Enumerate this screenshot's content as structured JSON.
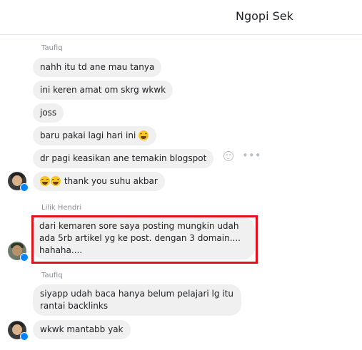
{
  "header": {
    "title": "Ngopi Sek"
  },
  "groups": [
    {
      "sender": "Taufiq",
      "messages": [
        "nahh itu td ane mau tanya",
        "ini keren amat om skrg wkwk",
        "joss",
        "baru pakai lagi hari ini",
        "dr pagi keasikan ane temakin blogspot",
        "thank you suhu akbar"
      ]
    },
    {
      "sender": "Lilik Hendri",
      "messages": [
        "dari kemaren sore saya posting mungkin udah ada 5rb artikel yg ke post. dengan 3 domain.... hahaha...."
      ]
    },
    {
      "sender": "Taufiq",
      "messages": [
        "siyapp udah baca hanya belum pelajari lg itu rantai backlinks",
        "wkwk mantabb yak"
      ]
    }
  ],
  "icons": {
    "emoji": "laughing-emoji-icon",
    "react": "smiley-react-icon",
    "more": "more-options-icon",
    "badge": "messenger-badge-icon"
  },
  "colors": {
    "bubble": "#f1f0f0",
    "highlight": "#e3101d",
    "messenger_blue": "#0084ff"
  }
}
